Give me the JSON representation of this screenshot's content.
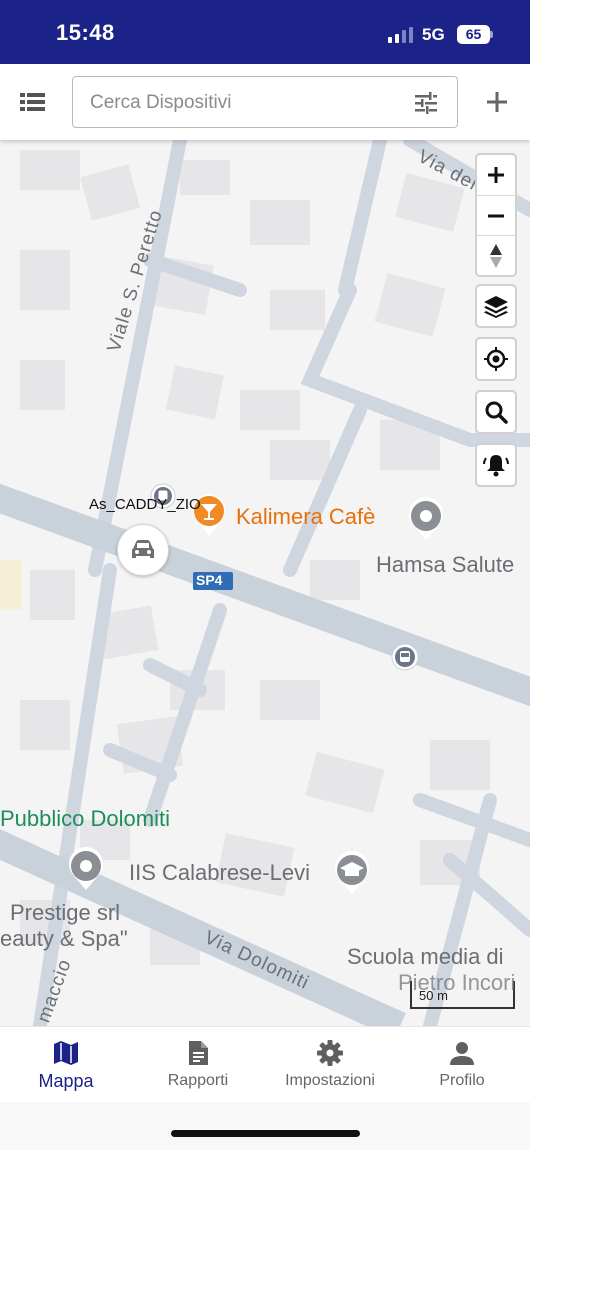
{
  "status_bar": {
    "time": "15:48",
    "network": "5G",
    "battery": "65",
    "background": "#1c2388"
  },
  "top_bar": {
    "list_icon": "list-icon",
    "search_placeholder": "Cerca Dispositivi",
    "filter_icon": "tune-icon",
    "add_icon": "plus-icon"
  },
  "map": {
    "streets": {
      "viale_peretto": "Viale S. Peretto",
      "via_dei": "Via dei",
      "via_dolomiti": "Via Dolomiti",
      "maccio": "maccio",
      "sp4": "SP4"
    },
    "pois": {
      "kalimera": "Kalimera Cafè",
      "hamsa": "Hamsa Salute",
      "pubblico": "Pubblico Dolomiti",
      "calabrese": "IIS Calabrese-Levi",
      "prestige_1": "Prestige srl",
      "prestige_2": "eauty & Spa\"",
      "scuola_1": "Scuola media di",
      "scuola_2": "Pietro Incori"
    },
    "vehicle_label": "As_CADDY_ZIO",
    "scale_label": "50 m",
    "controls": [
      "zoom-in",
      "zoom-out",
      "compass",
      "layers",
      "my-location",
      "search",
      "alarm"
    ],
    "colors": {
      "road": "#cfd6df",
      "building": "#e4e4e6",
      "poi_orange": "#e8710a",
      "poi_green": "#1e8e5a"
    }
  },
  "bottom_nav": {
    "items": [
      {
        "label": "Mappa",
        "icon": "map-icon",
        "active": true
      },
      {
        "label": "Rapporti",
        "icon": "document-icon",
        "active": false
      },
      {
        "label": "Impostazioni",
        "icon": "gear-icon",
        "active": false
      },
      {
        "label": "Profilo",
        "icon": "person-icon",
        "active": false
      }
    ],
    "active_color": "#1c2388"
  }
}
